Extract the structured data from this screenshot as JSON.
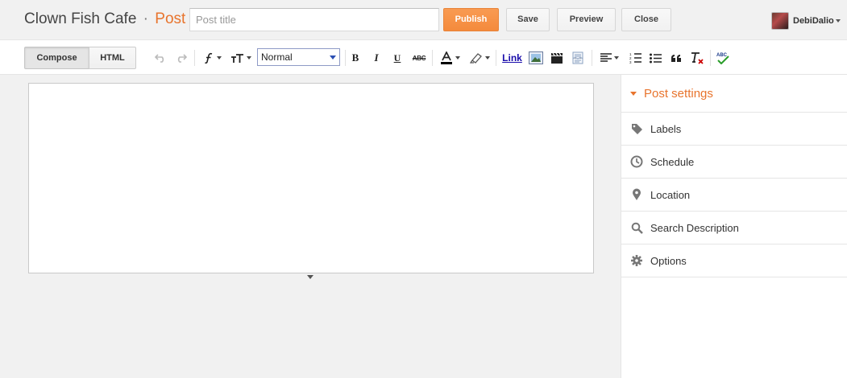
{
  "header": {
    "blog_name": "Clown Fish Cafe",
    "separator": "·",
    "section": "Post",
    "title_placeholder": "Post title",
    "publish_label": "Publish",
    "save_label": "Save",
    "preview_label": "Preview",
    "close_label": "Close",
    "user_name": "DebiDalio"
  },
  "toolbar": {
    "compose_label": "Compose",
    "html_label": "HTML",
    "format_value": "Normal",
    "bold_glyph": "B",
    "italic_glyph": "I",
    "underline_glyph": "U",
    "strike_glyph": "ABC",
    "link_label": "Link",
    "icons": [
      "undo-icon",
      "redo-icon",
      "font-family-icon",
      "font-size-icon",
      "bold-icon",
      "italic-icon",
      "underline-icon",
      "strikethrough-icon",
      "text-color-icon",
      "highlight-icon",
      "insert-image-icon",
      "insert-video-icon",
      "jump-break-icon",
      "align-icon",
      "numbered-list-icon",
      "bulleted-list-icon",
      "quote-icon",
      "remove-formatting-icon",
      "spell-check-icon"
    ]
  },
  "sidebar": {
    "title": "Post settings",
    "items": [
      {
        "label": "Labels",
        "icon": "tag-icon"
      },
      {
        "label": "Schedule",
        "icon": "clock-icon"
      },
      {
        "label": "Location",
        "icon": "location-pin-icon"
      },
      {
        "label": "Search Description",
        "icon": "search-icon"
      },
      {
        "label": "Options",
        "icon": "gear-icon"
      }
    ]
  },
  "colors": {
    "accent": "#e8742d",
    "publish": "#f48a3c",
    "link": "#1a0dab"
  }
}
